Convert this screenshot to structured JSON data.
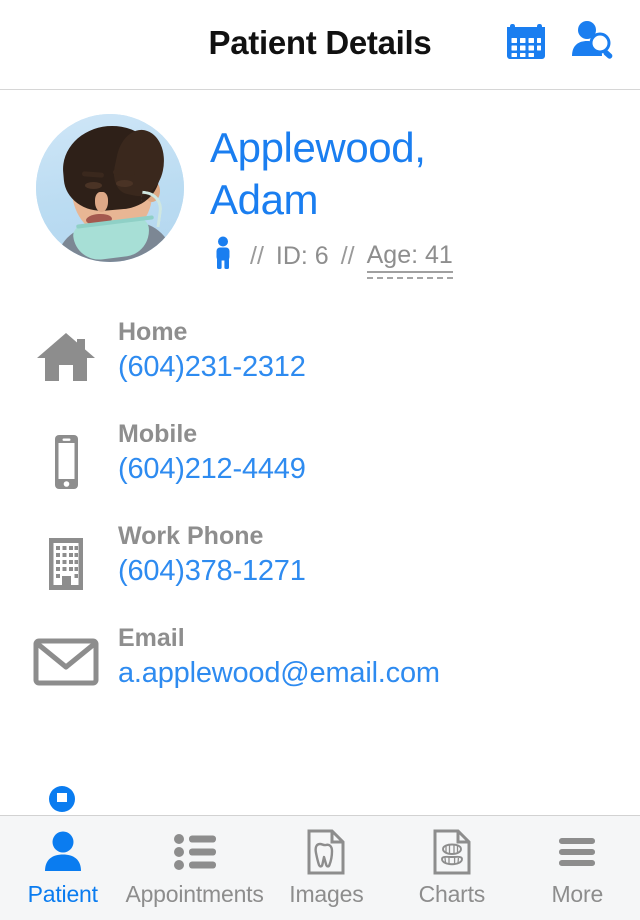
{
  "header": {
    "title": "Patient Details",
    "actions": [
      {
        "name": "calendar-icon",
        "label": "Calendar"
      },
      {
        "name": "patient-search-icon",
        "label": "Search Patient"
      }
    ]
  },
  "patient": {
    "name": "Applewood, Adam",
    "avatar_alt": "Patient photo",
    "gender_icon": "male-figure-icon",
    "separator": "//",
    "id_label": "ID: 6",
    "age_label": "Age: 41"
  },
  "contacts": [
    {
      "icon": "home-icon",
      "label": "Home",
      "value": "(604)231-2312"
    },
    {
      "icon": "mobile-icon",
      "label": "Mobile",
      "value": "(604)212-4449"
    },
    {
      "icon": "building-icon",
      "label": "Work Phone",
      "value": "(604)378-1271"
    },
    {
      "icon": "envelope-icon",
      "label": "Email",
      "value": "a.applewood@email.com"
    }
  ],
  "tabs": [
    {
      "id": "patient",
      "label": "Patient",
      "icon": "person-icon",
      "active": true
    },
    {
      "id": "appointments",
      "label": "Appointments",
      "icon": "list-icon",
      "active": false
    },
    {
      "id": "images",
      "label": "Images",
      "icon": "document-tooth-icon",
      "active": false
    },
    {
      "id": "charts",
      "label": "Charts",
      "icon": "document-teeth-icon",
      "active": false
    },
    {
      "id": "more",
      "label": "More",
      "icon": "hamburger-icon",
      "active": false
    }
  ],
  "colors": {
    "accent": "#0a7cf0",
    "name_blue": "#1a7ef0",
    "value_blue": "#2e8bf0",
    "label_gray": "#8e8e8e",
    "icon_gray": "#8d8d8d",
    "tabbar_bg": "#f5f6f7"
  }
}
